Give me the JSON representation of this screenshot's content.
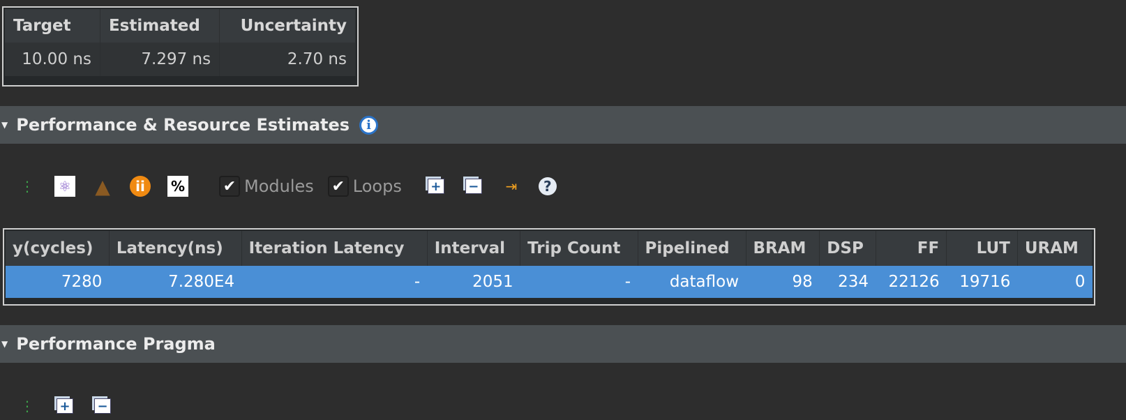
{
  "timing": {
    "headers": [
      "Target",
      "Estimated",
      "Uncertainty"
    ],
    "values": [
      "10.00 ns",
      "7.297 ns",
      "2.70 ns"
    ]
  },
  "perf_section": {
    "title": "Performance & Resource Estimates",
    "info_icon": "info-icon"
  },
  "toolbar": {
    "modules_label": "Modules",
    "modules_checked": true,
    "loops_label": "Loops",
    "loops_checked": true,
    "percent_label": "%"
  },
  "perf_table": {
    "headers": [
      "y(cycles)",
      "Latency(ns)",
      "Iteration Latency",
      "Interval",
      "Trip Count",
      "Pipelined",
      "BRAM",
      "DSP",
      "FF",
      "LUT",
      "URAM"
    ],
    "row": [
      "7280",
      "7.280E4",
      "-",
      "2051",
      "-",
      "dataflow",
      "98",
      "234",
      "22126",
      "19716",
      "0"
    ],
    "selected_color": "#4a8fd6"
  },
  "pragma_section": {
    "title": "Performance Pragma"
  }
}
